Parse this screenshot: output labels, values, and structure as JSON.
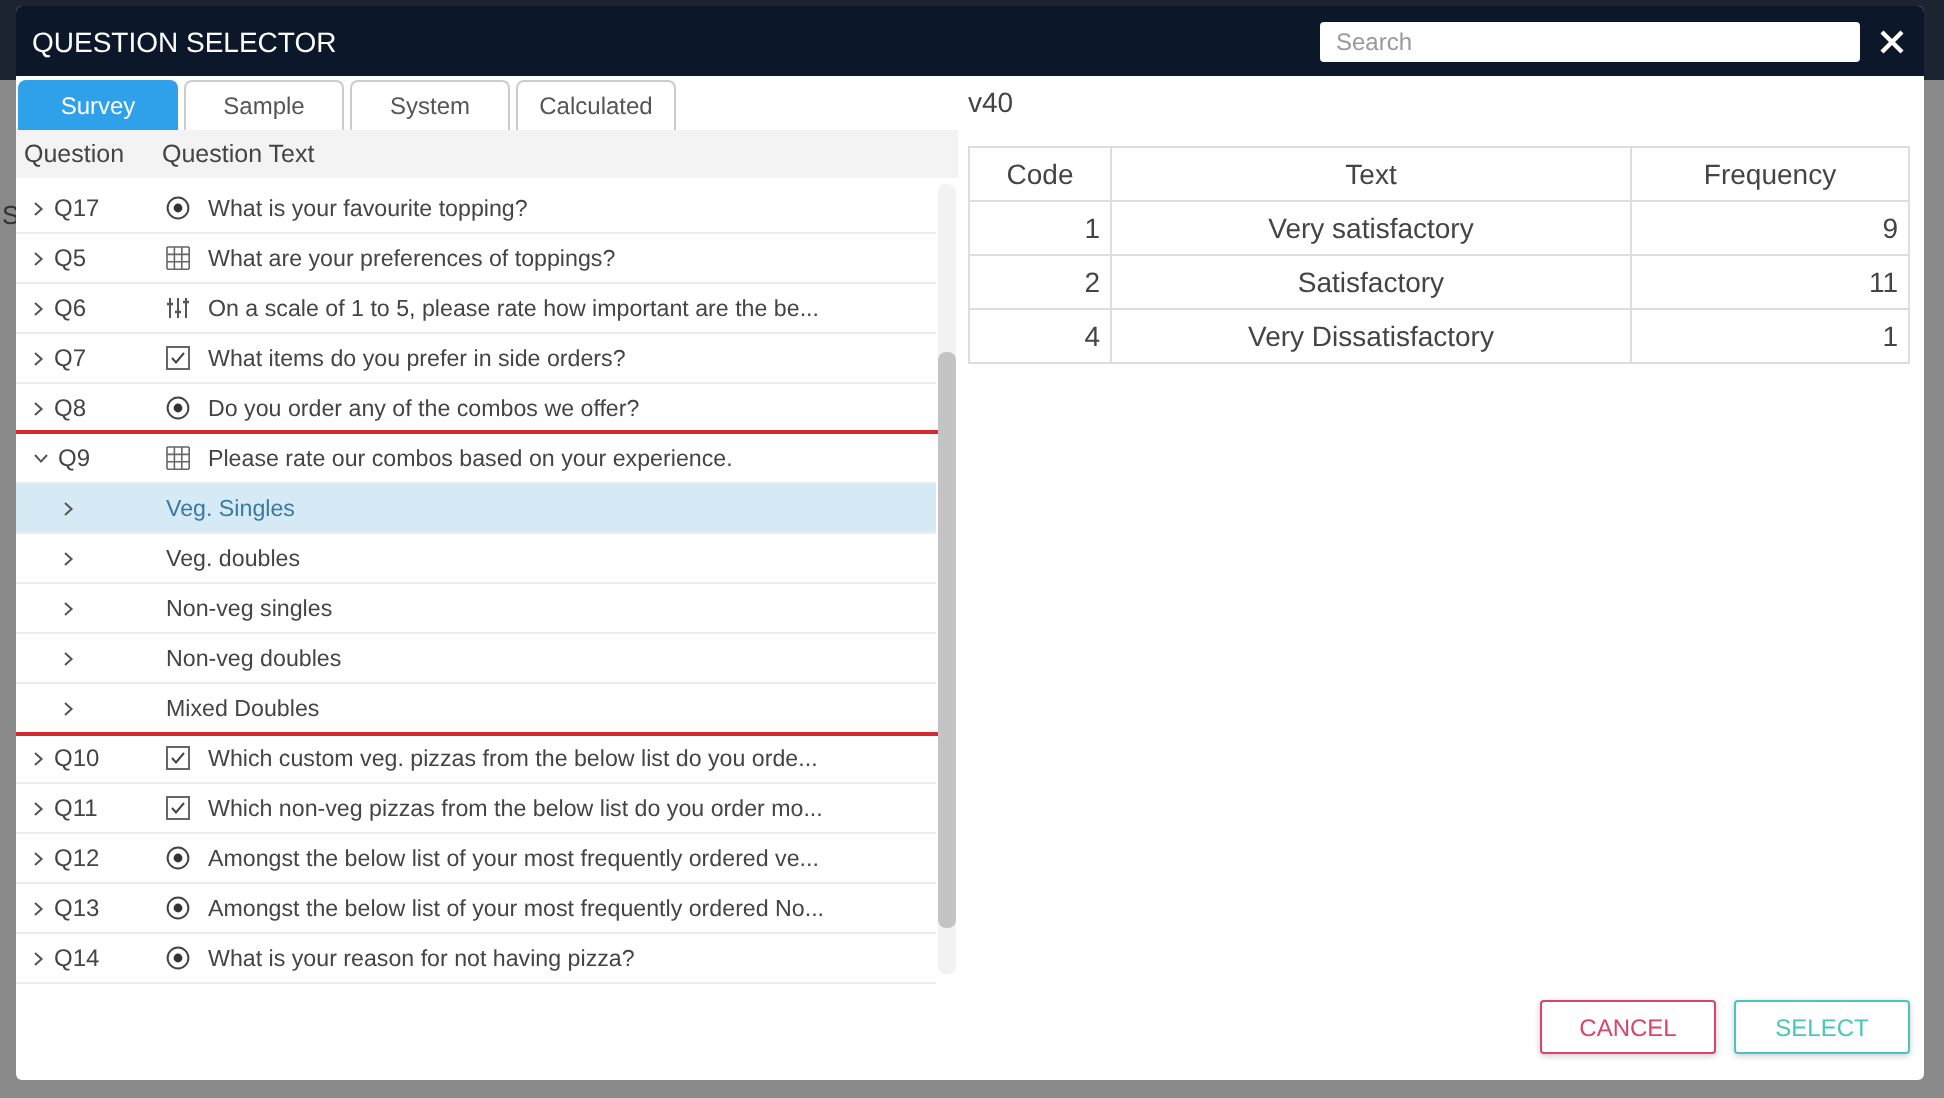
{
  "backdrop": {
    "texts": [
      "S"
    ]
  },
  "dialog": {
    "title": "QUESTION SELECTOR",
    "search": {
      "placeholder": "Search"
    },
    "tabs": [
      {
        "label": "Survey",
        "selected": true
      },
      {
        "label": "Sample",
        "selected": false
      },
      {
        "label": "System",
        "selected": false
      },
      {
        "label": "Calculated",
        "selected": false
      }
    ],
    "columns": [
      "Question",
      "Question Text"
    ],
    "questions": [
      {
        "code": "Q17",
        "kind": "radio",
        "text": "What is your favourite topping?",
        "expanded": false,
        "highlighted": false
      },
      {
        "code": "Q5",
        "kind": "grid",
        "text": "What are your preferences of toppings?",
        "expanded": false,
        "highlighted": false
      },
      {
        "code": "Q6",
        "kind": "scale",
        "text": "On a scale of 1 to 5, please rate how important are the be...",
        "expanded": false,
        "highlighted": false
      },
      {
        "code": "Q7",
        "kind": "checkbox",
        "text": "What items do you prefer in side orders?",
        "expanded": false,
        "highlighted": false
      },
      {
        "code": "Q8",
        "kind": "radio",
        "text": "Do you order any of the combos we offer?",
        "expanded": false,
        "highlighted": false
      },
      {
        "code": "Q9",
        "kind": "grid",
        "text": "Please rate our combos based on your experience.",
        "expanded": true,
        "highlighted": true,
        "children": [
          {
            "text": "Veg. Singles",
            "selected": true
          },
          {
            "text": "Veg. doubles",
            "selected": false
          },
          {
            "text": "Non-veg singles",
            "selected": false
          },
          {
            "text": "Non-veg doubles",
            "selected": false
          },
          {
            "text": "Mixed Doubles",
            "selected": false
          }
        ]
      },
      {
        "code": "Q10",
        "kind": "checkbox",
        "text": "Which custom veg. pizzas from the below list do you orde...",
        "expanded": false,
        "highlighted": false
      },
      {
        "code": "Q11",
        "kind": "checkbox",
        "text": "Which non-veg pizzas from the below list do you order mo...",
        "expanded": false,
        "highlighted": false
      },
      {
        "code": "Q12",
        "kind": "radio",
        "text": "Amongst the below list of your most frequently ordered ve...",
        "expanded": false,
        "highlighted": false
      },
      {
        "code": "Q13",
        "kind": "radio",
        "text": "Amongst the below list of your most frequently ordered No...",
        "expanded": false,
        "highlighted": false
      },
      {
        "code": "Q14",
        "kind": "radio",
        "text": "What is your reason for not having pizza?",
        "expanded": false,
        "highlighted": false
      }
    ],
    "detail": {
      "variable": "v40",
      "columns": [
        "Code",
        "Text",
        "Frequency"
      ],
      "rows": [
        [
          "1",
          "Very satisfactory",
          "9"
        ],
        [
          "2",
          "Satisfactory",
          "11"
        ],
        [
          "4",
          "Very Dissatisfactory",
          "1"
        ]
      ]
    },
    "buttons": [
      {
        "label": "CANCEL",
        "kind": "cancel"
      },
      {
        "label": "SELECT",
        "kind": "confirm"
      }
    ]
  }
}
